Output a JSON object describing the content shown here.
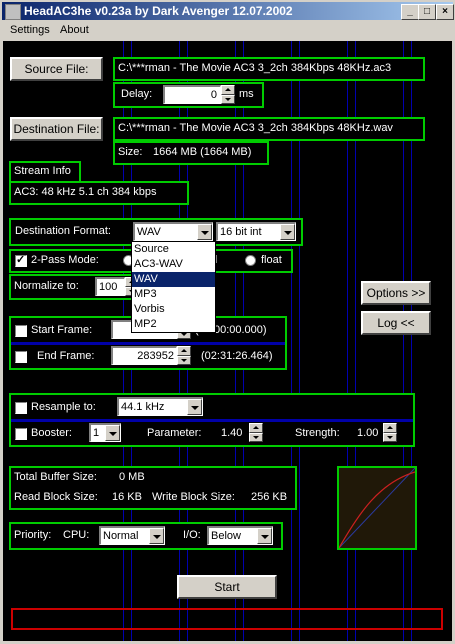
{
  "window": {
    "title": "HeadAC3he v0.23a by Dark Avenger 12.07.2002",
    "buttons": {
      "minimize": "_",
      "maximize": "□",
      "close": "×"
    }
  },
  "menu": [
    "Settings",
    "About"
  ],
  "source": {
    "button": "Source File:",
    "path": "C:\\***rman - The Movie AC3 3_2ch 384Kbps 48KHz.ac3",
    "delay_label": "Delay:",
    "delay_value": "0",
    "delay_unit": "ms"
  },
  "destination": {
    "button": "Destination File:",
    "path": "C:\\***rman - The Movie AC3 3_2ch 384Kbps 48KHz.wav",
    "size_label": "Size:",
    "size_value": "1664 MB  (1664 MB)"
  },
  "stream_info": {
    "heading": "Stream Info",
    "details": "AC3:  48 kHz   5.1 ch    384 kbps"
  },
  "format": {
    "label": "Destination Format:",
    "selected": "WAV",
    "bitdepth": "16 bit int",
    "options": [
      "Source",
      "AC3-WAV",
      "WAV",
      "MP3",
      "Vorbis",
      "MP2"
    ],
    "selected_index": 2
  },
  "pass_mode": {
    "label": "2-Pass Mode:",
    "checked": true,
    "radio_hybrid": "rid",
    "radio_float": "float"
  },
  "normalize": {
    "label": "Normalize to:",
    "value": "100"
  },
  "side_buttons": {
    "options": "Options >>",
    "log": "Log <<"
  },
  "frames": {
    "start_label": "Start Frame:",
    "start_time": "(00:00:00.000)",
    "end_label": "End Frame:",
    "end_value": "283952",
    "end_time": "(02:31:26.464)"
  },
  "resample": {
    "label": "Resample to:",
    "value": "44.1 kHz",
    "booster_label": "Booster:",
    "booster_value": "1",
    "parameter_label": "Parameter:",
    "parameter_value": "1.40",
    "strength_label": "Strength:",
    "strength_value": "1.00"
  },
  "buffer": {
    "total_label": "Total Buffer Size:",
    "total_value": "0 MB",
    "read_label": "Read Block Size:",
    "read_value": "16 KB",
    "write_label": "Write Block Size:",
    "write_value": "256 KB"
  },
  "priority": {
    "label": "Priority:",
    "cpu_label": "CPU:",
    "cpu_value": "Normal",
    "io_label": "I/O:",
    "io_value": "Below"
  },
  "start_button": "Start",
  "colors": {
    "group_border": "#00cc00",
    "background": "#000000",
    "accent_lines": "#0000b0",
    "progress_border": "#cc0000",
    "title_bar": "#0a246a"
  },
  "progress_fraction": 0
}
